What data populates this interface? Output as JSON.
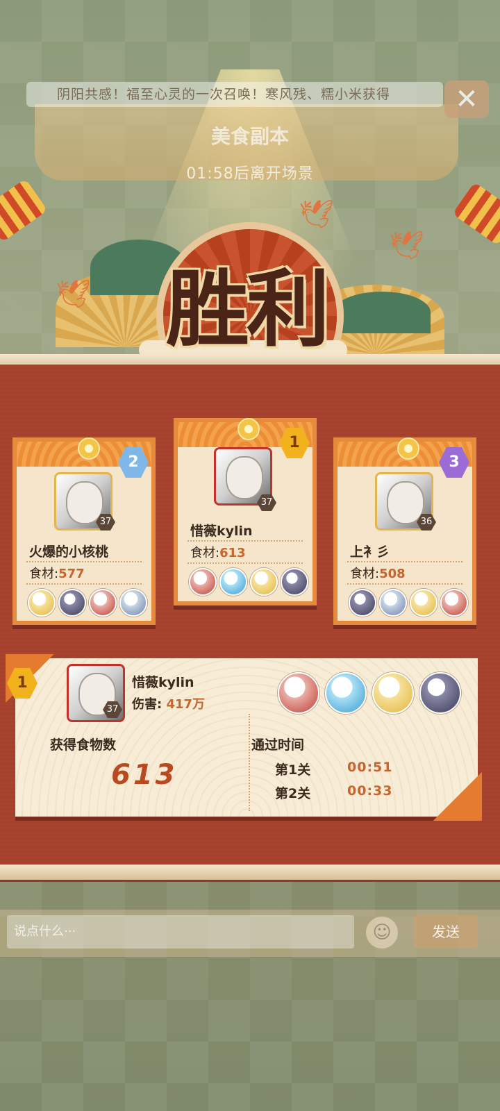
{
  "marquee": "阴阳共感！福至心灵的一次召唤！寒风残、糯小米获得",
  "close_icon_glyph": "✕",
  "dungeon_title": "美食副本",
  "leave_timer": "01:58后离开场景",
  "victory_text": "胜利",
  "food_label": "食材:",
  "players": [
    {
      "rank": "2",
      "name": "火爆的小核桃",
      "food": "577",
      "level": "37",
      "rank_color": "#7fb8e8"
    },
    {
      "rank": "1",
      "name": "惜薇kylin",
      "food": "613",
      "level": "37",
      "rank_color": "#f1b21d"
    },
    {
      "rank": "3",
      "name": "上衤彡",
      "food": "508",
      "level": "36",
      "rank_color": "#9b6bd6"
    }
  ],
  "mvp": {
    "rank": "1",
    "name": "惜薇kylin",
    "level": "37",
    "damage_label": "伤害:",
    "damage_value": "417万",
    "food_count_label": "获得食物数",
    "food_count": "613",
    "time_label": "通过时间",
    "stages": [
      {
        "label": "第1关",
        "time": "00:51"
      },
      {
        "label": "第2关",
        "time": "00:33"
      }
    ]
  },
  "chat": {
    "placeholder": "说点什么···",
    "send_label": "发送",
    "emoji_icon": "face-emoji-icon"
  }
}
